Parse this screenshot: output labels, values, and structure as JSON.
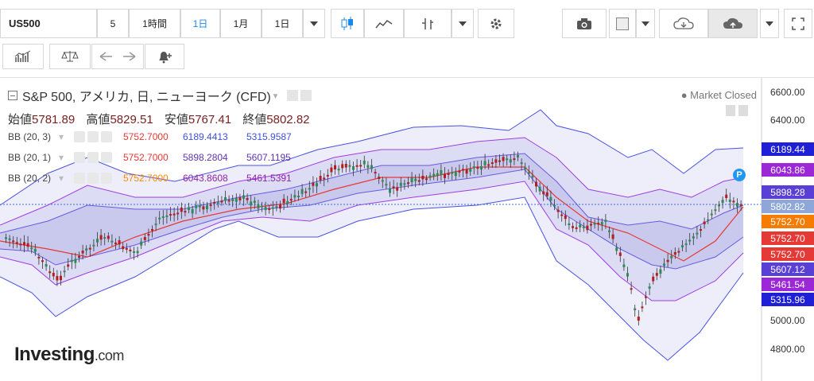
{
  "toolbar": {
    "symbol": "US500",
    "interval_5": "5",
    "interval_1h": "1時間",
    "interval_1d_active": "1日",
    "interval_1m": "1月",
    "interval_1d": "1日"
  },
  "legend": {
    "title": "S&P 500, アメリカ, 日, ニューヨーク (CFD)",
    "open_label": "始値",
    "open": "5781.89",
    "high_label": "高値",
    "high": "5829.51",
    "low_label": "安値",
    "low": "5767.41",
    "close_label": "終値",
    "close": "5802.82",
    "market_status": "● Market Closed"
  },
  "indicators": [
    {
      "name": "BB (20, 3)",
      "mid": "5752.7000",
      "upper": "6189.4413",
      "lower": "5315.9587",
      "mid_color": "#e53935",
      "up_color": "#3f51d8",
      "low_color": "#3f51d8"
    },
    {
      "name": "BB (20, 1)",
      "mid": "5752.7000",
      "upper": "5898.2804",
      "lower": "5607.1195",
      "mid_color": "#e53935",
      "up_color": "#5e35b1",
      "low_color": "#5e35b1"
    },
    {
      "name": "BB (20, 2)",
      "mid": "5752.7000",
      "upper": "6043.8608",
      "lower": "5461.5391",
      "mid_color": "#fb8c00",
      "up_color": "#8e24aa",
      "low_color": "#8e24aa"
    }
  ],
  "y_axis": [
    "6600.00",
    "6400.00",
    "5000.00",
    "4800.00"
  ],
  "price_tags": [
    {
      "value": "6189.44",
      "color": "#1f1fd6"
    },
    {
      "value": "6043.86",
      "color": "#9c27d6"
    },
    {
      "value": "5898.28",
      "color": "#5a3fd6"
    },
    {
      "value": "5802.82",
      "color": "#8fa7d8"
    },
    {
      "value": "5752.70",
      "color": "#f57c00"
    },
    {
      "value": "5752.70",
      "color": "#e53935"
    },
    {
      "value": "5752.70",
      "color": "#e53935"
    },
    {
      "value": "5607.12",
      "color": "#5a3fd6"
    },
    {
      "value": "5461.54",
      "color": "#9c27d6"
    },
    {
      "value": "5315.96",
      "color": "#1f1fd6"
    }
  ],
  "logo": {
    "main": "Investing",
    "suffix": ".com"
  },
  "badge": "P"
}
